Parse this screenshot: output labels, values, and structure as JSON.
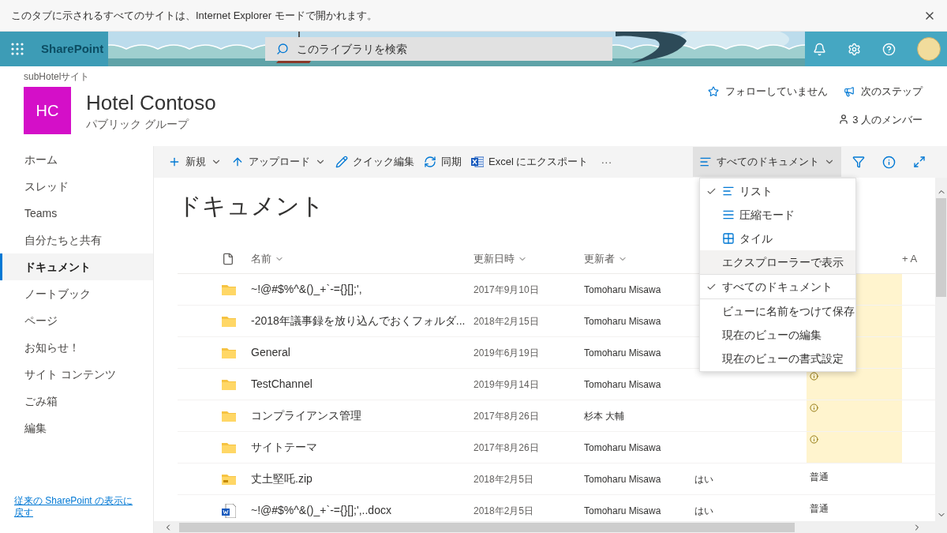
{
  "notification_bar": {
    "text": "このタブに示されるすべてのサイトは、Internet Explorer モードで開かれます。"
  },
  "suite_bar": {
    "app_name": "SharePoint",
    "search": {
      "placeholder": "このライブラリを検索"
    }
  },
  "site_header": {
    "breadcrumb": "subHotelサイト",
    "logo": "HC",
    "title": "Hotel Contoso",
    "subtitle": "パブリック グループ",
    "actions": [
      {
        "kind": "follow",
        "label": "フォローしていません"
      },
      {
        "kind": "next",
        "label": "次のステップ"
      }
    ],
    "members": "3 人のメンバー"
  },
  "nav": {
    "items": [
      {
        "label": "ホーム",
        "selected": false
      },
      {
        "label": "スレッド",
        "selected": false
      },
      {
        "label": "Teams",
        "selected": false
      },
      {
        "label": "自分たちと共有",
        "selected": false
      },
      {
        "label": "ドキュメント",
        "selected": true
      },
      {
        "label": "ノートブック",
        "selected": false
      },
      {
        "label": "ページ",
        "selected": false
      },
      {
        "label": "お知らせ！",
        "selected": false
      },
      {
        "label": "サイト コンテンツ",
        "selected": false
      },
      {
        "label": "ごみ箱",
        "selected": false
      },
      {
        "label": "編集",
        "selected": false
      }
    ],
    "footer_link": "従来の SharePoint の表示に戻す"
  },
  "command_bar": {
    "commands": [
      {
        "kind": "new",
        "label": "新規",
        "dropdown": true
      },
      {
        "kind": "upload",
        "label": "アップロード",
        "dropdown": true
      },
      {
        "kind": "edit",
        "label": "クイック編集",
        "dropdown": false
      },
      {
        "kind": "sync",
        "label": "同期",
        "dropdown": false
      },
      {
        "kind": "excel",
        "label": "Excel にエクスポート",
        "dropdown": false
      }
    ],
    "more": "···",
    "view_switcher": {
      "label": "すべてのドキュメント",
      "expanded": true
    }
  },
  "page_title": "ドキュメント",
  "table": {
    "columns": [
      {
        "label": "名前"
      },
      {
        "label": "更新日時"
      },
      {
        "label": "更新者"
      }
    ],
    "add_column": "+ A",
    "rows": [
      {
        "kind": "folder",
        "name": "~!@#$%^&()_+`-={}[];',",
        "modified": "2017年9月10日",
        "modified_by": "Tomoharu Misawa",
        "highlighted": true,
        "warning": false
      },
      {
        "kind": "folder",
        "name": "-2018年議事録を放り込んでおくフォルダ...",
        "modified": "2018年2月15日",
        "modified_by": "Tomoharu Misawa",
        "highlighted": true,
        "warning": false
      },
      {
        "kind": "folder",
        "name": "General",
        "modified": "2019年6月19日",
        "modified_by": "Tomoharu Misawa",
        "highlighted": true,
        "warning": false
      },
      {
        "kind": "folder",
        "name": "TestChannel",
        "modified": "2019年9月14日",
        "modified_by": "Tomoharu Misawa",
        "highlighted": true,
        "warning": true
      },
      {
        "kind": "folder",
        "name": "コンプライアンス管理",
        "modified": "2017年8月26日",
        "modified_by": "杉本 大輔",
        "highlighted": true,
        "warning": true
      },
      {
        "kind": "folder",
        "name": "サイトテーマ",
        "modified": "2017年8月26日",
        "modified_by": "Tomoharu Misawa",
        "highlighted": true,
        "warning": true
      },
      {
        "kind": "zip",
        "name": "丈土堅吒.zip",
        "modified": "2018年2月5日",
        "modified_by": "Tomoharu Misawa",
        "column_4": "はい",
        "column_5": "普通",
        "highlighted": false,
        "warning": false
      },
      {
        "kind": "word",
        "name": "~!@#$%^&()_+`-={}[];',..docx",
        "modified": "2018年2月5日",
        "modified_by": "Tomoharu Misawa",
        "column_4": "はい",
        "column_5": "普通",
        "highlighted": false,
        "warning": false
      }
    ]
  },
  "view_menu": {
    "groups": [
      {
        "items": [
          {
            "kind": "list",
            "label": "リスト",
            "checked": true,
            "hovered": false
          },
          {
            "kind": "compact",
            "label": "圧縮モード",
            "checked": false,
            "hovered": false
          },
          {
            "kind": "tiles",
            "label": "タイル",
            "checked": false,
            "hovered": false
          },
          {
            "label": "エクスプローラーで表示",
            "checked": false,
            "hovered": true
          }
        ]
      },
      {
        "items": [
          {
            "label": "すべてのドキュメント",
            "checked": true,
            "hovered": false
          }
        ]
      },
      {
        "items": [
          {
            "label": "ビューに名前をつけて保存",
            "checked": false,
            "hovered": false
          },
          {
            "label": "現在のビューの編集",
            "checked": false,
            "hovered": false
          },
          {
            "label": "現在のビューの書式設定",
            "checked": false,
            "hovered": false
          }
        ]
      }
    ]
  }
}
